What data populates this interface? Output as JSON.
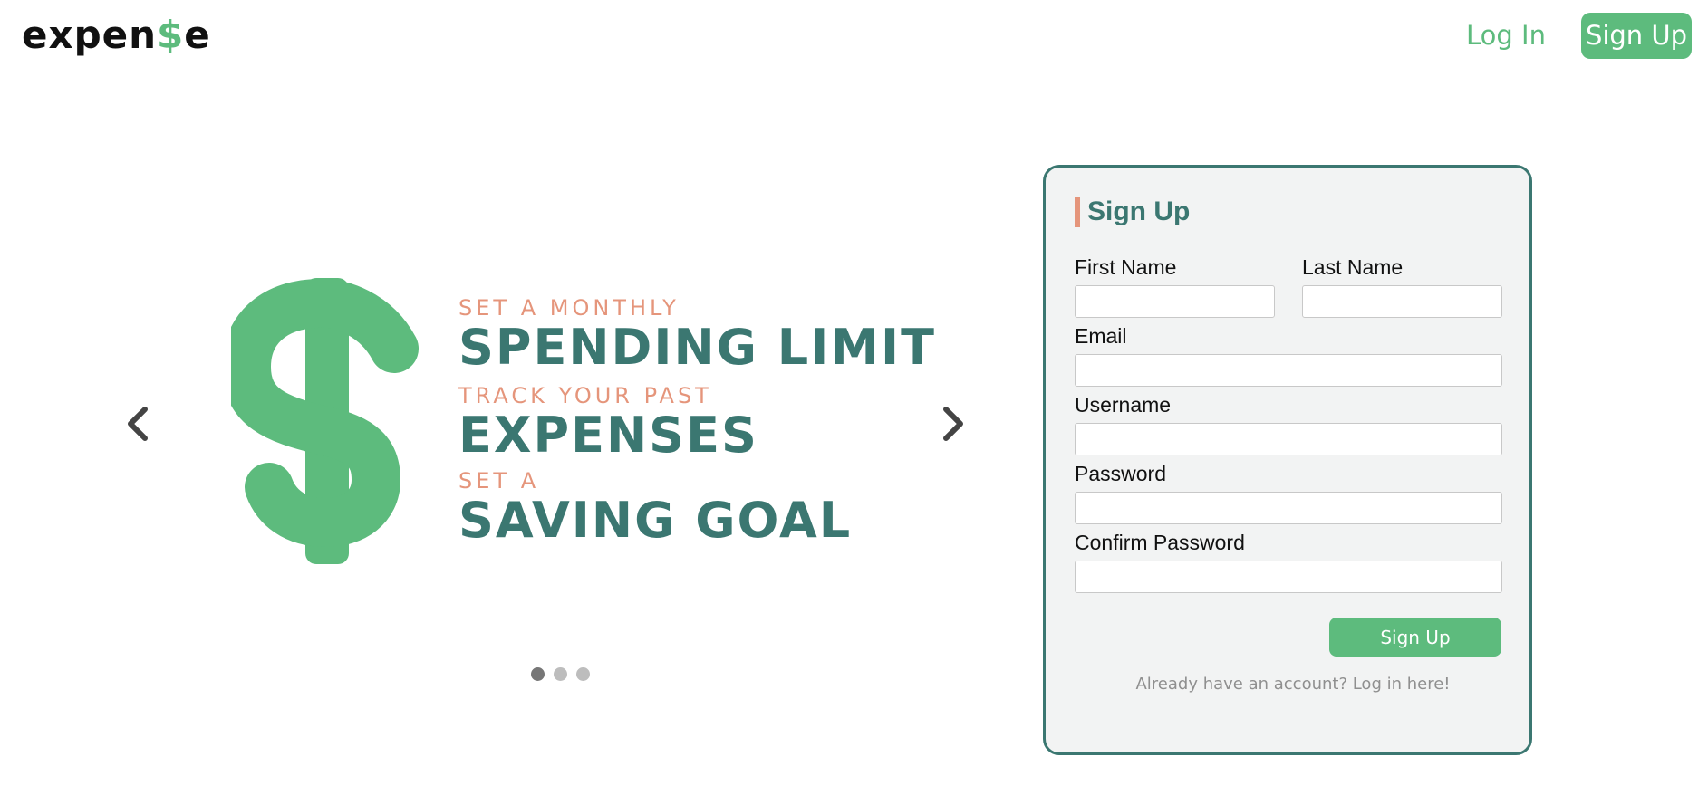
{
  "header": {
    "logo_prefix": "expen",
    "logo_symbol": "$",
    "logo_suffix": "e",
    "login_label": "Log In",
    "signup_label": "Sign Up"
  },
  "carousel": {
    "slogans": [
      {
        "small": "SET A MONTHLY",
        "big": "SPENDING LIMIT"
      },
      {
        "small": "TRACK YOUR PAST",
        "big": "EXPENSES"
      },
      {
        "small": "SET A",
        "big": "SAVING GOAL"
      }
    ],
    "slide_count": 3,
    "active_slide": 1,
    "icons": {
      "prev": "chevron-left-icon",
      "next": "chevron-right-icon",
      "graphic": "dollar-sign-icon"
    }
  },
  "form": {
    "title": "Sign Up",
    "first_name_label": "First Name",
    "last_name_label": "Last Name",
    "email_label": "Email",
    "username_label": "Username",
    "password_label": "Password",
    "confirm_password_label": "Confirm Password",
    "first_name_value": "",
    "last_name_value": "",
    "email_value": "",
    "username_value": "",
    "password_value": "",
    "confirm_password_value": "",
    "submit_label": "Sign Up",
    "login_prompt": "Already have an account? Log in here!"
  },
  "colors": {
    "brand_green": "#5dbb7d",
    "teal": "#3b7771",
    "salmon": "#e5957b",
    "card_background": "#f2f3f3"
  }
}
